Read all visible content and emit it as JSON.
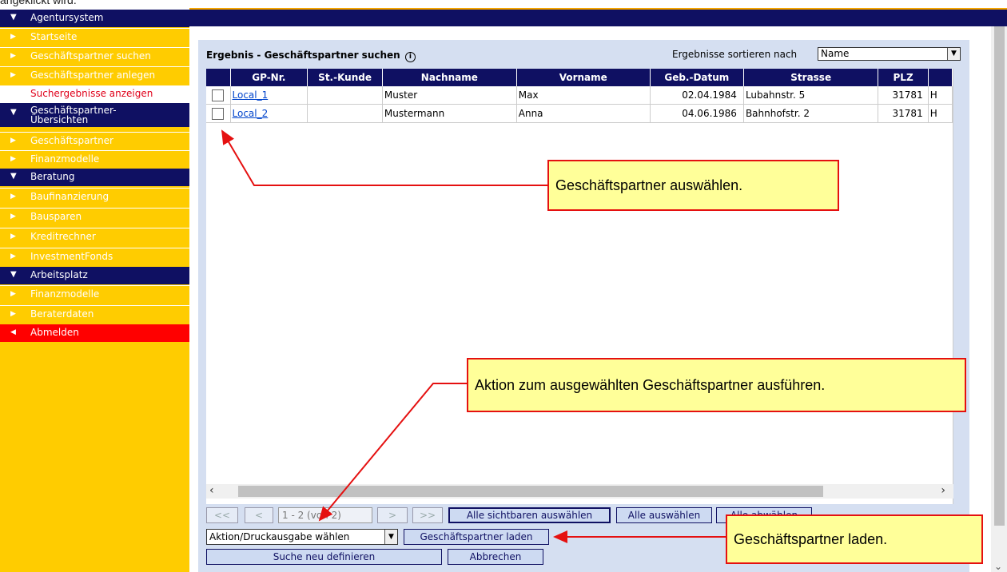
{
  "doc_text": "angeklickt wird.",
  "sidebar": {
    "items": [
      {
        "label": "Agentursystem",
        "type": "head"
      },
      {
        "label": "Startseite",
        "type": "link"
      },
      {
        "label": "Geschäftspartner suchen",
        "type": "link"
      },
      {
        "label": "Geschäftspartner anlegen",
        "type": "link"
      },
      {
        "label": "Suchergebnisse anzeigen",
        "type": "active"
      },
      {
        "label": "Geschäftspartner-",
        "label2": "Übersichten",
        "type": "head"
      },
      {
        "label": "Geschäftspartner",
        "type": "link"
      },
      {
        "label": "Finanzmodelle",
        "type": "link"
      },
      {
        "label": "Beratung",
        "type": "head"
      },
      {
        "label": "Baufinanzierung",
        "type": "link"
      },
      {
        "label": "Bausparen",
        "type": "link"
      },
      {
        "label": "Kreditrechner",
        "type": "link"
      },
      {
        "label": "InvestmentFonds",
        "type": "link"
      },
      {
        "label": "Arbeitsplatz",
        "type": "head"
      },
      {
        "label": "Finanzmodelle",
        "type": "link"
      },
      {
        "label": "Beraterdaten",
        "type": "link"
      },
      {
        "label": "Abmelden",
        "type": "logout"
      }
    ]
  },
  "main": {
    "title": "Ergebnis - Geschäftspartner suchen",
    "info_icon": "i",
    "sort_label": "Ergebnisse sortieren nach",
    "sort_value": "Name",
    "table": {
      "columns": [
        "GP-Nr.",
        "St.-Kunde",
        "Nachname",
        "Vorname",
        "Geb.-Datum",
        "Strasse",
        "PLZ"
      ],
      "rows": [
        {
          "gp": "Local_1",
          "st": "",
          "nachname": "Muster",
          "vorname": "Max",
          "geb": "02.04.1984",
          "strasse": "Lubahnstr. 5",
          "plz": "31781",
          "extra": "H"
        },
        {
          "gp": "Local_2",
          "st": "",
          "nachname": "Mustermann",
          "vorname": "Anna",
          "geb": "04.06.1986",
          "strasse": "Bahnhofstr. 2",
          "plz": "31781",
          "extra": "H"
        }
      ]
    },
    "pager": {
      "first": "<<",
      "prev": "<",
      "info": "1 - 2 (von 2)",
      "next": ">",
      "last": ">>"
    },
    "buttons": {
      "select_visible": "Alle sichtbaren auswählen",
      "select_all": "Alle auswählen",
      "deselect_all": "Alle abwählen",
      "load_partner": "Geschäftspartner laden",
      "redefine_search": "Suche neu definieren",
      "cancel": "Abbrechen"
    },
    "action_select": "Aktion/Druckausgabe wählen"
  },
  "callouts": {
    "select_partner": "Geschäftspartner auswählen.",
    "execute_action": "Aktion zum ausgewählten Geschäftspartner ausführen.",
    "load_partner": "Geschäftspartner laden."
  },
  "colors": {
    "nav_dark": "#0f1062",
    "nav_yellow": "#ffcc00",
    "logout_red": "#ff0000",
    "callout_bg": "#ffff99",
    "callout_border": "#e51010"
  }
}
